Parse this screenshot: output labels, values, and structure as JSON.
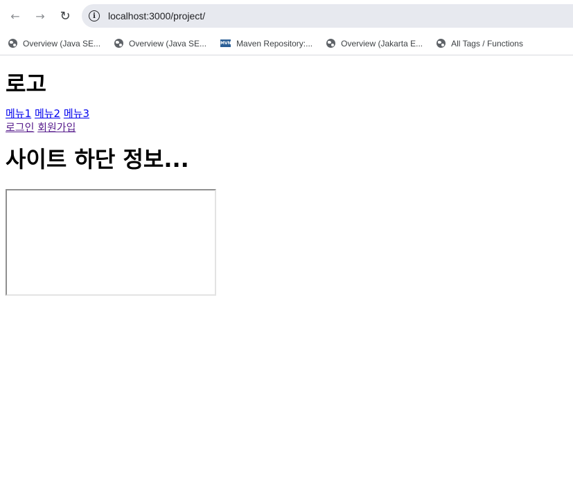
{
  "browser": {
    "url": "localhost:3000/project/",
    "bookmarks": [
      {
        "label": "Overview (Java SE...",
        "icon": "globe-icon"
      },
      {
        "label": "Overview (Java SE...",
        "icon": "globe-icon"
      },
      {
        "label": "Maven Repository:...",
        "icon": "maven-icon",
        "icon_text": "MVN"
      },
      {
        "label": "Overview (Jakarta E...",
        "icon": "globe-icon"
      },
      {
        "label": "All Tags / Functions",
        "icon": "globe-icon"
      }
    ]
  },
  "page": {
    "logo": "로고",
    "menu": [
      "메뉴1",
      "메뉴2",
      "메뉴3"
    ],
    "auth": {
      "login": "로그인",
      "signup": "회원가입"
    },
    "footer_title": "사이트 하단 정보..."
  }
}
